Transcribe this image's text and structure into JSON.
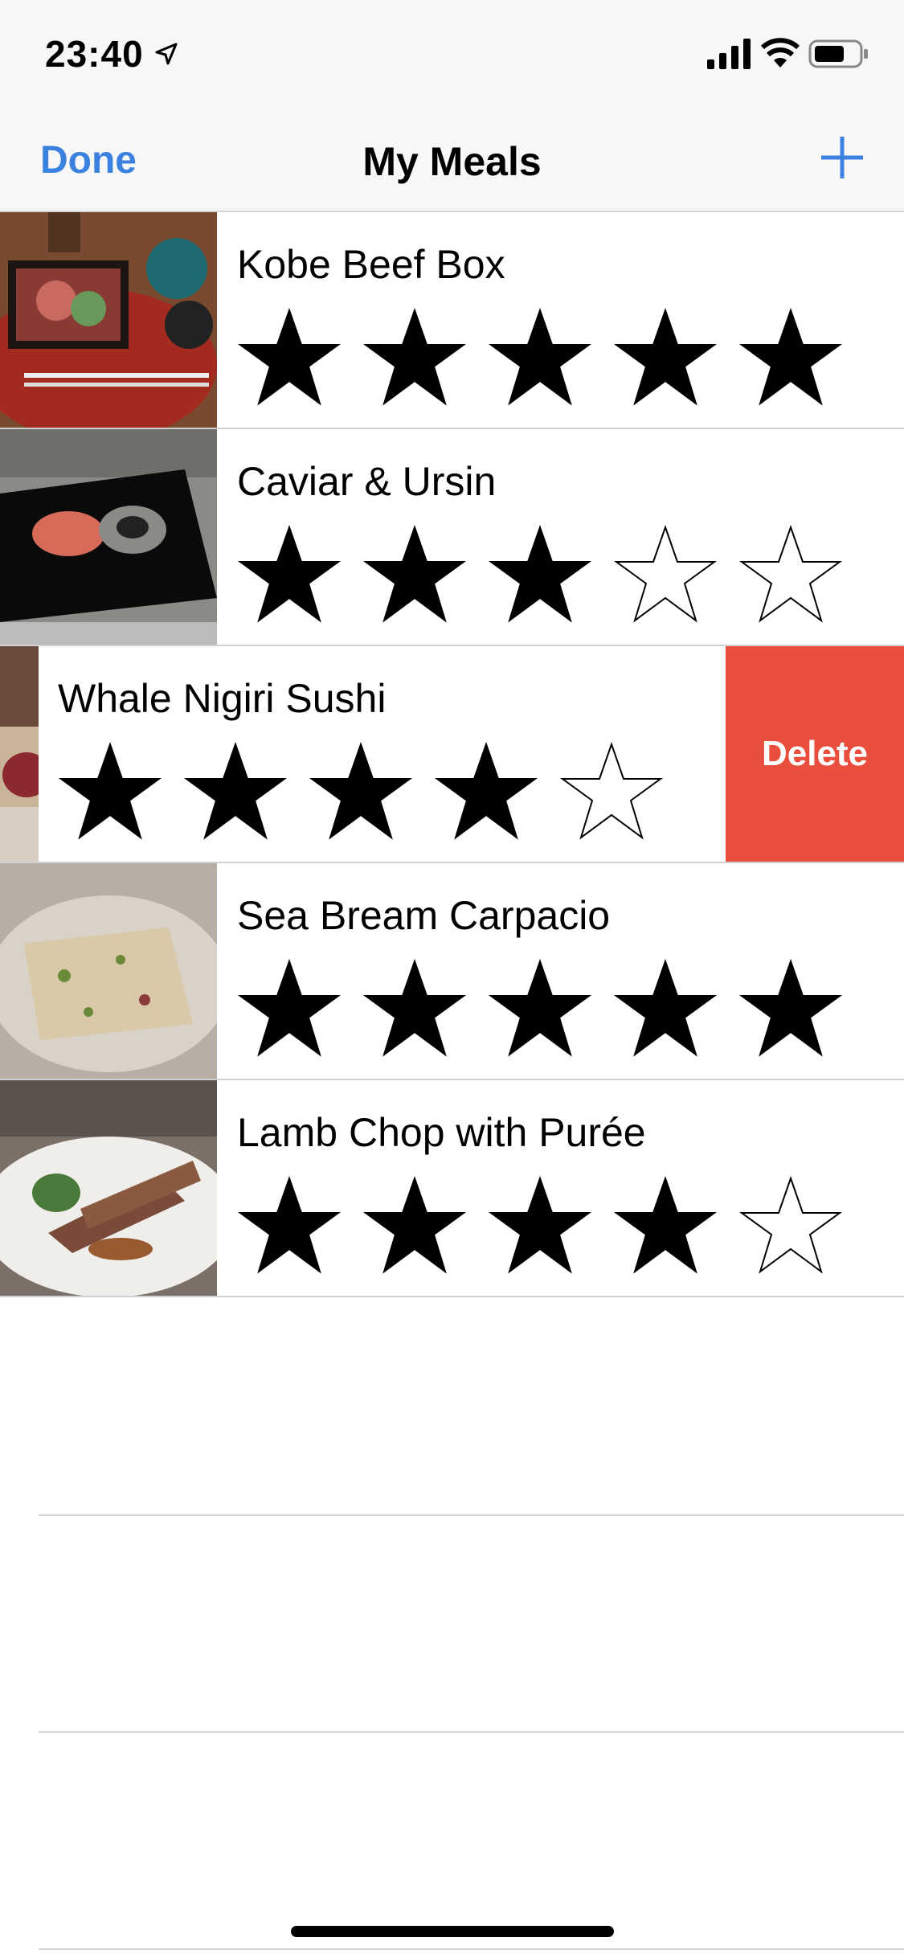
{
  "status": {
    "time": "23:40"
  },
  "nav": {
    "done_label": "Done",
    "title": "My Meals",
    "add_icon": "plus-icon"
  },
  "meals": [
    {
      "name": "Kobe Beef Box",
      "rating": 5
    },
    {
      "name": "Caviar & Ursin",
      "rating": 3
    },
    {
      "name": "Whale Nigiri Sushi",
      "rating": 4,
      "swiped": true
    },
    {
      "name": "Sea Bream Carpacio",
      "rating": 5
    },
    {
      "name": "Lamb Chop with Purée",
      "rating": 4
    }
  ],
  "delete_label": "Delete",
  "colors": {
    "accent": "#3b82e0",
    "delete": "#ea4f3d"
  }
}
